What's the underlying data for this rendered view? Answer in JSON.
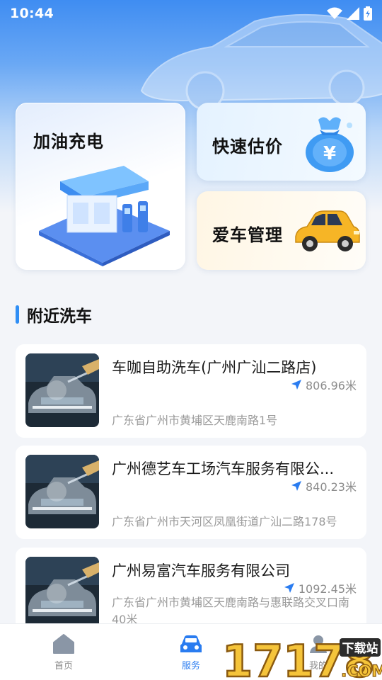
{
  "status_bar": {
    "time": "10:44"
  },
  "features": {
    "big": {
      "title": "加油充电"
    },
    "quote": {
      "title": "快速估价"
    },
    "care": {
      "title": "爱车管理"
    }
  },
  "section": {
    "title": "附近洗车"
  },
  "shops": [
    {
      "name": "车咖自助洗车(广州广汕二路店)",
      "distance": "806.96米",
      "address": "广东省广州市黄埔区天鹿南路1号"
    },
    {
      "name": "广州德艺车工场汽车服务有限公...",
      "distance": "840.23米",
      "address": "广东省广州市天河区凤凰街道广汕二路178号"
    },
    {
      "name": "广州易富汽车服务有限公司",
      "distance": "1092.45米",
      "address": "广东省广州市黄埔区天鹿南路与惠联路交叉口南40米"
    }
  ],
  "tabs": [
    {
      "label": "首页",
      "icon": "home-icon"
    },
    {
      "label": "服务",
      "icon": "car-icon"
    },
    {
      "label": "我的",
      "icon": "user-icon"
    }
  ],
  "watermark": {
    "text": "17178",
    "badge": "下载站",
    "suffix": ".COM"
  },
  "colors": {
    "accent": "#2a7cf0",
    "section_bar": "#2f8ef5"
  }
}
